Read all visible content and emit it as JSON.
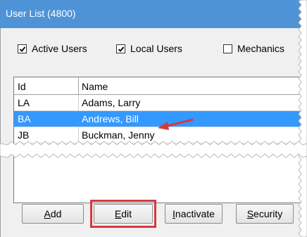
{
  "window": {
    "title": "User List (4800)"
  },
  "filters": [
    {
      "pre": "",
      "accel": "",
      "post": "Active Users",
      "checked": true
    },
    {
      "pre": "",
      "accel": "",
      "post": "Local Users",
      "checked": true
    },
    {
      "pre": "",
      "accel": "",
      "post": "Mechanics",
      "checked": false
    }
  ],
  "grid": {
    "columns": [
      "Id",
      "Name"
    ],
    "rows": [
      {
        "id": "LA",
        "name": "Adams, Larry",
        "selected": false
      },
      {
        "id": "BA",
        "name": "Andrews, Bill",
        "selected": true
      },
      {
        "id": "JB",
        "name": "Buckman, Jenny",
        "selected": false
      }
    ]
  },
  "buttons": [
    {
      "pre": "",
      "accel": "A",
      "post": "dd"
    },
    {
      "pre": "",
      "accel": "E",
      "post": "dit"
    },
    {
      "pre": "",
      "accel": "I",
      "post": "nactivate"
    },
    {
      "pre": "",
      "accel": "S",
      "post": "ecurity"
    }
  ],
  "colors": {
    "title_bar": "#4e93d6",
    "selection": "#3399ff",
    "annotation": "#d33a3f",
    "window_bg": "#f0f0f0"
  }
}
